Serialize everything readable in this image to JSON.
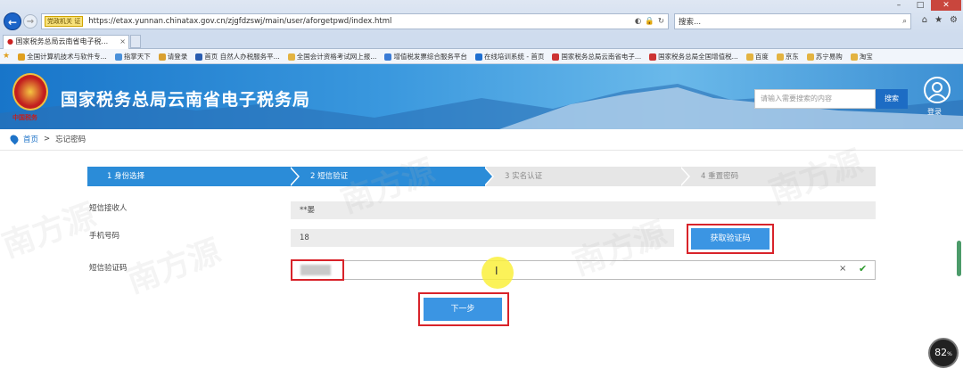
{
  "browser": {
    "security_badge": "党政机关 证",
    "url": "https://etax.yunnan.chinatax.gov.cn/zjgfdzswj/main/user/aforgetpwd/index.html",
    "search_placeholder": "搜索...",
    "tab_title": "国家税务总局云南省电子税..."
  },
  "favorites": [
    {
      "label": "全国计算机技术与软件专...",
      "color": "#e0a020"
    },
    {
      "label": "指掌天下",
      "color": "#4a90d9"
    },
    {
      "label": "请登录",
      "color": "#d9a030"
    },
    {
      "label": "首页  自然人办税服务平...",
      "color": "#2a5db0"
    },
    {
      "label": "全国会计资格考试网上报...",
      "color": "#e3b341"
    },
    {
      "label": "增值税发票综合服务平台",
      "color": "#3a7bd5"
    },
    {
      "label": "在线培训系统 - 首页",
      "color": "#1f6fd0"
    },
    {
      "label": "国家税务总局云南省电子...",
      "color": "#c33"
    },
    {
      "label": "国家税务总局全国增值税...",
      "color": "#c33"
    },
    {
      "label": "百度",
      "color": "#e3b341"
    },
    {
      "label": "京东",
      "color": "#e3b341"
    },
    {
      "label": "苏宁易购",
      "color": "#e3b341"
    },
    {
      "label": "淘宝",
      "color": "#e3b341"
    }
  ],
  "header": {
    "title": "国家税务总局云南省电子税务局",
    "emblem_caption": "中国税务",
    "search_placeholder": "请输入需要搜索的内容",
    "search_button": "搜索",
    "login": "登录"
  },
  "breadcrumb": {
    "home": "首页",
    "separator": ">",
    "current": "忘记密码"
  },
  "steps": [
    {
      "label": "1  身份选择",
      "active": true
    },
    {
      "label": "2  短信验证",
      "active": true
    },
    {
      "label": "3  实名认证",
      "active": false
    },
    {
      "label": "4  重置密码",
      "active": false
    }
  ],
  "form": {
    "recipient_label": "短信接收人",
    "recipient_value": "**晏",
    "phone_label": "手机号码",
    "phone_value": "18",
    "get_code_button": "获取验证码",
    "code_label": "短信验证码",
    "clear_icon": "×",
    "check_icon": "✔",
    "next_button": "下一步"
  },
  "watermark_text": "南方源",
  "zoom_level": "82"
}
